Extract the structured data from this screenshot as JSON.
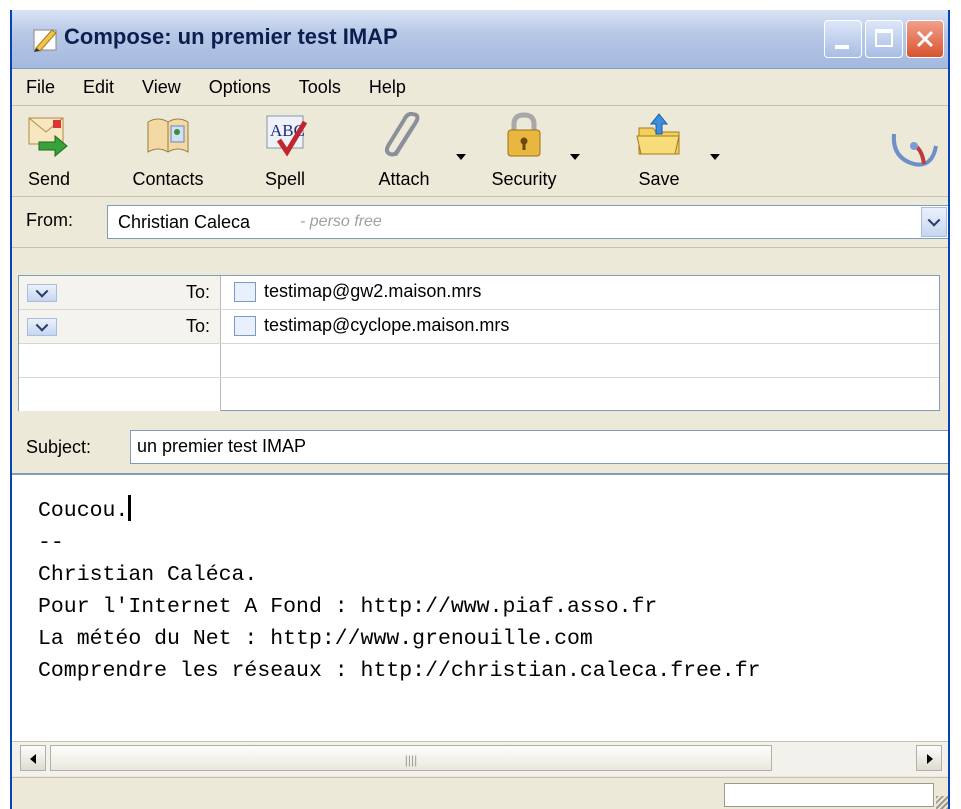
{
  "window": {
    "title": "Compose: un premier test IMAP"
  },
  "menu": [
    "File",
    "Edit",
    "View",
    "Options",
    "Tools",
    "Help"
  ],
  "toolbar": {
    "send": "Send",
    "contacts": "Contacts",
    "spell": "Spell",
    "attach": "Attach",
    "security": "Security",
    "save": "Save"
  },
  "from": {
    "label": "From:",
    "name": "Christian Caleca",
    "account": "- perso free"
  },
  "recipients": [
    {
      "type": "To:",
      "address": "testimap@gw2.maison.mrs"
    },
    {
      "type": "To:",
      "address": "testimap@cyclope.maison.mrs"
    }
  ],
  "subject": {
    "label": "Subject:",
    "value": "un premier test IMAP"
  },
  "body": {
    "lines": [
      "Coucou.",
      "--",
      "Christian Caléca.",
      "Pour l'Internet A Fond : http://www.piaf.asso.fr",
      "La météo du Net : http://www.grenouille.com",
      "Comprendre les réseaux : http://christian.caleca.free.fr"
    ]
  },
  "colors": {
    "title_bar": "#a4b9df",
    "window_frame": "#0842b4",
    "face": "#ece9d8",
    "close_button": "#d9532f"
  },
  "icons": [
    "compose-icon",
    "send-icon",
    "contacts-icon",
    "spell-icon",
    "attach-icon",
    "security-icon",
    "save-icon",
    "throbber-icon",
    "card-icon",
    "chevron-down-icon"
  ]
}
